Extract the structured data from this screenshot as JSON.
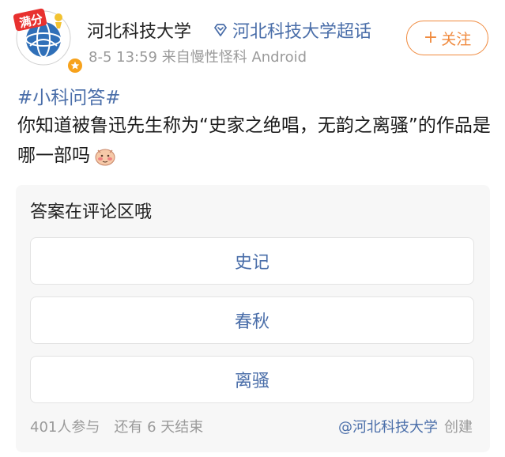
{
  "author": {
    "name": "河北科技大学",
    "avatar_badge_text": "满分",
    "verified_icon": "star-icon",
    "time": "8-5 13:59",
    "source": "来自慢性怪科 Android"
  },
  "topic": {
    "icon": "super-topic-diamond-icon",
    "label": "河北科技大学超话"
  },
  "follow_button": {
    "icon": "plus-icon",
    "label": "关注"
  },
  "post": {
    "hashtag": "#小科问答#",
    "text": "你知道被鲁迅先生称为“史家之绝唱，无韵之离骚”的作品是哪一部吗",
    "emoji": "shy-face-emoji-icon"
  },
  "poll": {
    "title": "答案在评论区哦",
    "options": [
      {
        "label": "史记"
      },
      {
        "label": "春秋"
      },
      {
        "label": "离骚"
      }
    ],
    "participants": "401人参与",
    "remaining": "还有 6 天结束",
    "creator": "@河北科技大学",
    "created_label": "创建"
  },
  "colors": {
    "link_blue": "#4a6ea9",
    "follow_orange": "#f08a3e",
    "meta_gray": "#9a9a9a",
    "card_bg": "#f7f7f7"
  }
}
